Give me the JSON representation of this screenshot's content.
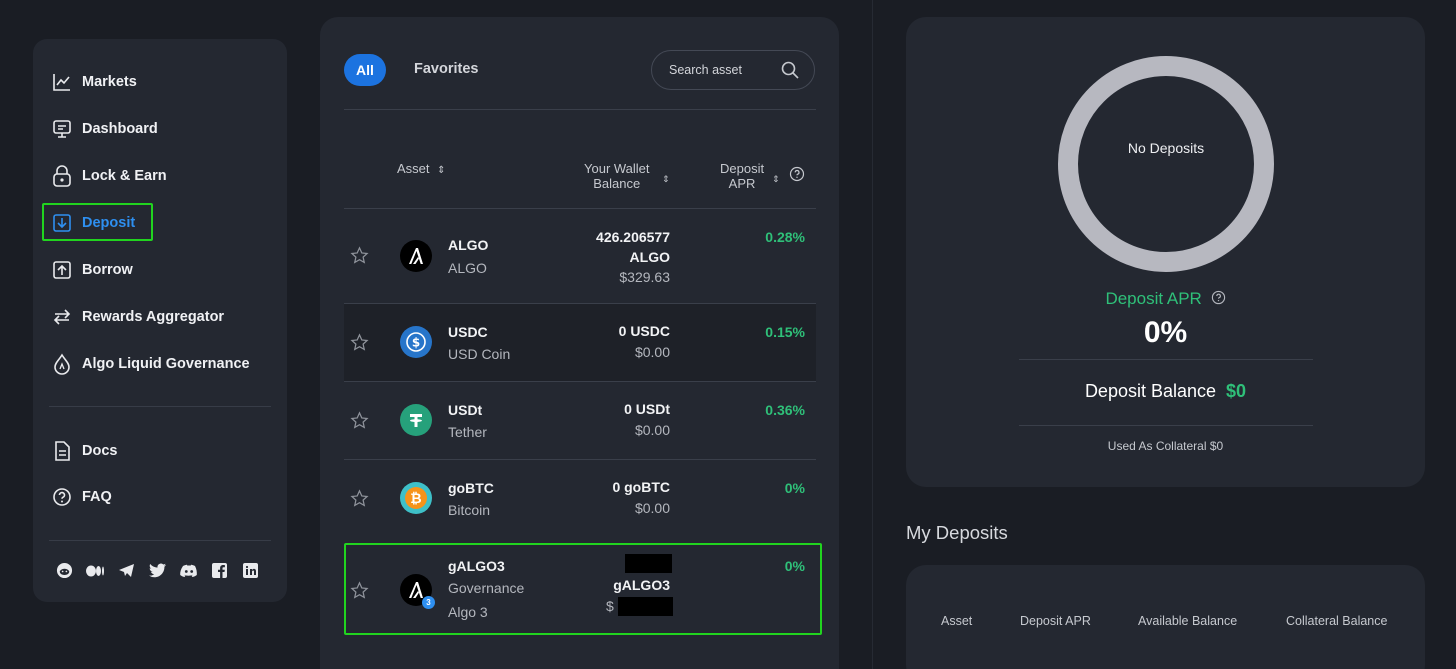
{
  "sidebar": {
    "items": [
      {
        "label": "Markets",
        "icon": "chart-icon"
      },
      {
        "label": "Dashboard",
        "icon": "monitor-icon"
      },
      {
        "label": "Lock & Earn",
        "icon": "lock-icon"
      },
      {
        "label": "Deposit",
        "icon": "deposit-icon",
        "active": true
      },
      {
        "label": "Borrow",
        "icon": "borrow-icon"
      },
      {
        "label": "Rewards Aggregator",
        "icon": "swap-arrows-icon"
      },
      {
        "label": "Algo Liquid Governance",
        "icon": "drop-icon"
      }
    ],
    "secondary": [
      {
        "label": "Docs",
        "icon": "document-icon"
      },
      {
        "label": "FAQ",
        "icon": "question-icon"
      }
    ],
    "socials": [
      "reddit-icon",
      "medium-icon",
      "telegram-icon",
      "twitter-icon",
      "discord-icon",
      "facebook-icon",
      "linkedin-icon"
    ]
  },
  "main": {
    "tabs": {
      "all": "All",
      "favorites": "Favorites"
    },
    "search_placeholder": "Search asset",
    "columns": {
      "asset": "Asset",
      "balance_1": "Your Wallet",
      "balance_2": "Balance",
      "apr_1": "Deposit",
      "apr_2": "APR"
    },
    "rows": [
      {
        "symbol": "ALGO",
        "name": "ALGO",
        "name2": "",
        "balance_1": "426.206577",
        "balance_2": "ALGO",
        "usd": "$329.63",
        "apr": "0.28%"
      },
      {
        "symbol": "USDC",
        "name": "USD Coin",
        "balance": "0 USDC",
        "usd": "$0.00",
        "apr": "0.15%"
      },
      {
        "symbol": "USDt",
        "name": "Tether",
        "balance": "0 USDt",
        "usd": "$0.00",
        "apr": "0.36%"
      },
      {
        "symbol": "goBTC",
        "name": "Bitcoin",
        "balance": "0 goBTC",
        "usd": "$0.00",
        "apr": "0%"
      },
      {
        "symbol": "gALGO3",
        "name": "Governance",
        "name2": "Algo 3",
        "balance": "gALGO3",
        "usd": "$",
        "apr": "0%"
      }
    ]
  },
  "summary": {
    "ring_label": "No Deposits",
    "apr_label": "Deposit APR",
    "apr_value": "0%",
    "balance_label": "Deposit Balance",
    "balance_value": "$0",
    "collateral": "Used As Collateral $0"
  },
  "my_deposits": {
    "title": "My Deposits",
    "columns": [
      "Asset",
      "Deposit APR",
      "Available Balance",
      "Collateral Balance"
    ]
  },
  "colors": {
    "accent": "#1c73e0",
    "positive": "#2fc079",
    "highlight": "#21d41f"
  }
}
